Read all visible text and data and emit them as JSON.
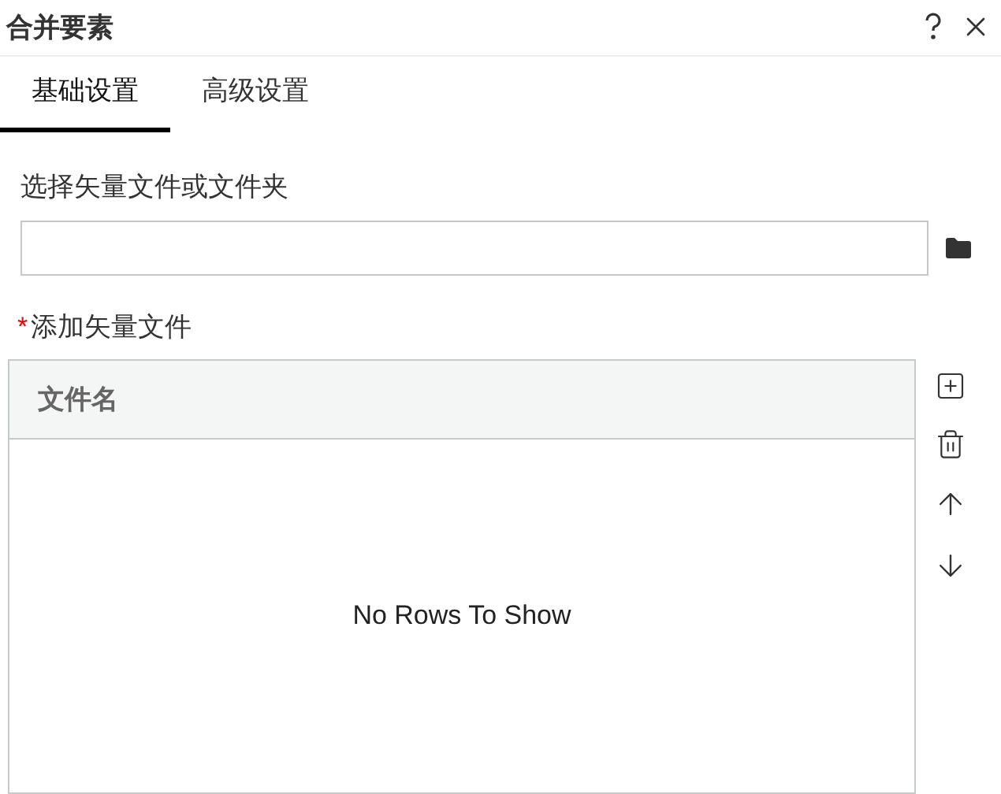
{
  "window": {
    "title": "合并要素"
  },
  "tabs": [
    {
      "label": "基础设置",
      "selected": true
    },
    {
      "label": "高级设置",
      "selected": false
    }
  ],
  "source_field": {
    "label": "选择矢量文件或文件夹"
  },
  "file_table": {
    "label": "添加矢量文件",
    "required_mark": "*",
    "columns": [
      "文件名"
    ],
    "empty_message": "No Rows To Show"
  }
}
